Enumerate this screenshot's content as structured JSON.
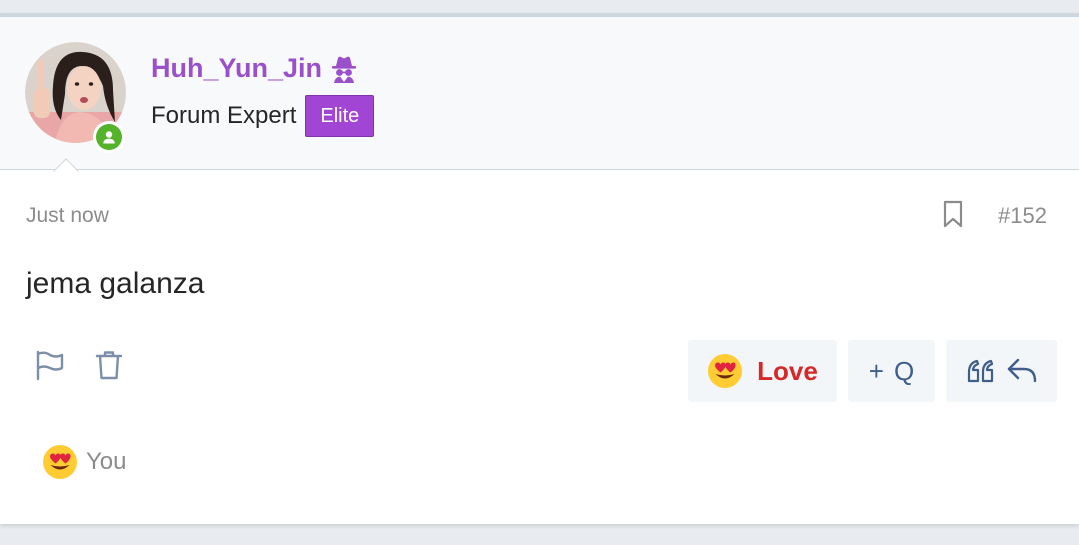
{
  "user": {
    "name": "Huh_Yun_Jin",
    "title": "Forum Expert",
    "badge": "Elite",
    "online": true
  },
  "post": {
    "time": "Just now",
    "number": "#152",
    "message": "jema galanza"
  },
  "actions": {
    "love_label": "Love",
    "add_quote_plus": "+",
    "add_quote_letter": "Q"
  },
  "reactions": {
    "emoji": "heart-eyes-emoji",
    "by": "You"
  },
  "colors": {
    "username": "#9a4fcb",
    "badge_bg": "#a146d4",
    "love": "#d62828",
    "online": "#54b22b",
    "action_bg": "#f3f6f8"
  }
}
